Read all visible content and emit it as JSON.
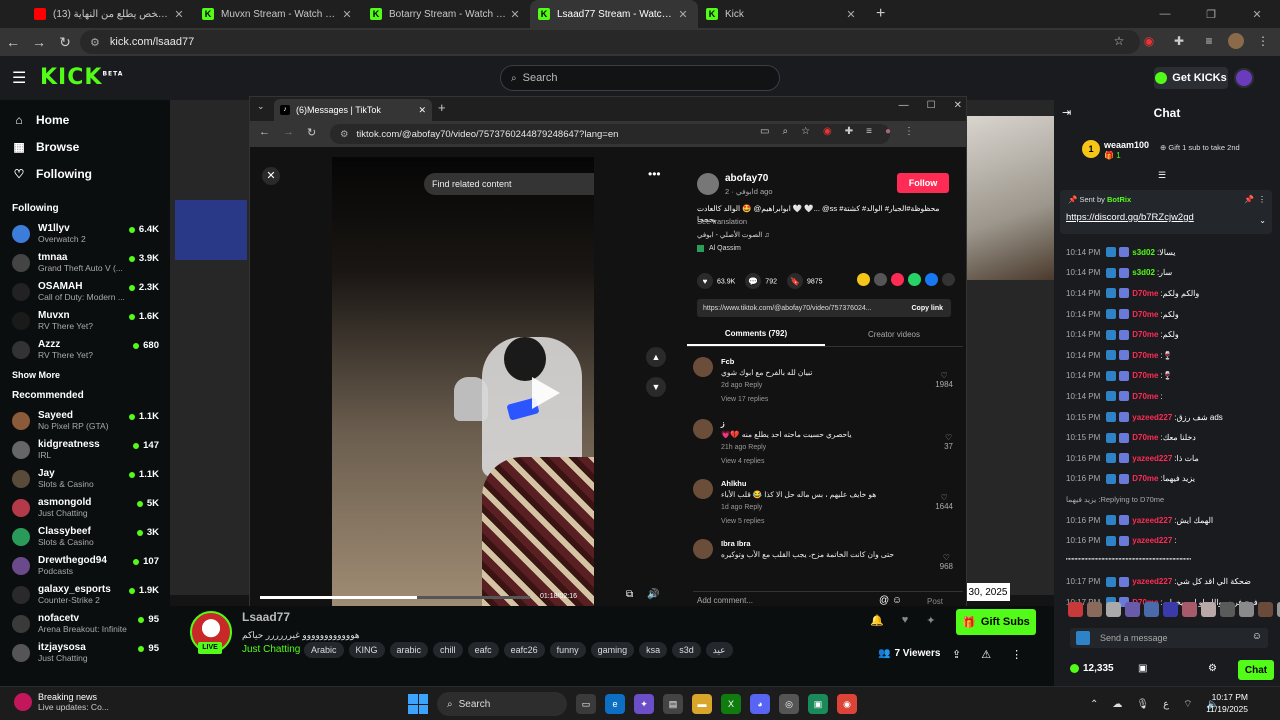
{
  "outer_browser": {
    "tabs": [
      {
        "label": "(13) اخر شخص يطلع من النهاية",
        "favicon": "youtube",
        "color": "#ff0000",
        "active": false
      },
      {
        "label": "Muvxn Stream - Watch Live on",
        "favicon": "kick",
        "color": "#53fc18",
        "active": false
      },
      {
        "label": "Botarry Stream - Watch Live on",
        "favicon": "kick",
        "color": "#53fc18",
        "active": false
      },
      {
        "label": "Lsaad77 Stream - Watch Live o",
        "favicon": "kick",
        "color": "#53fc18",
        "active": true
      },
      {
        "label": "Kick",
        "favicon": "kick",
        "color": "#53fc18",
        "active": false
      }
    ],
    "url": "kick.com/lsaad77"
  },
  "kick_header": {
    "logo": "KICK",
    "logo_badge": "BETA",
    "search_placeholder": "Search",
    "get_kicks": "Get KICKs"
  },
  "sidebar": {
    "nav": [
      {
        "label": "Home",
        "icon": "home-icon"
      },
      {
        "label": "Browse",
        "icon": "browse-icon"
      },
      {
        "label": "Following",
        "icon": "heart-icon"
      }
    ],
    "following_title": "Following",
    "following": [
      {
        "name": "W1llyv",
        "game": "Overwatch 2",
        "viewers": "6.4K",
        "color": "#3b7dd8"
      },
      {
        "name": "tmnaa",
        "game": "Grand Theft Auto V (...",
        "viewers": "3.9K",
        "color": "#444"
      },
      {
        "name": "OSAMAH",
        "game": "Call of Duty: Modern ...",
        "viewers": "2.3K",
        "color": "#222"
      },
      {
        "name": "Muvxn",
        "game": "RV There Yet?",
        "viewers": "1.6K",
        "color": "#1a1a1a"
      },
      {
        "name": "Azzz",
        "game": "RV There Yet?",
        "viewers": "680",
        "color": "#333"
      }
    ],
    "show_more": "Show More",
    "recommended_title": "Recommended",
    "recommended": [
      {
        "name": "Sayeed",
        "game": "No Pixel RP (GTA)",
        "viewers": "1.1K",
        "color": "#8a5a3a"
      },
      {
        "name": "kidgreatness",
        "game": "IRL",
        "viewers": "147",
        "color": "#666"
      },
      {
        "name": "Jay",
        "game": "Slots & Casino",
        "viewers": "1.1K",
        "color": "#5a4a3a"
      },
      {
        "name": "asmongold",
        "game": "Just Chatting",
        "viewers": "5K",
        "color": "#b43a4a"
      },
      {
        "name": "Classybeef",
        "game": "Slots & Casino",
        "viewers": "3K",
        "color": "#2a9a5a"
      },
      {
        "name": "Drewthegod94",
        "game": "Podcasts",
        "viewers": "107",
        "color": "#6a4a8a"
      },
      {
        "name": "galaxy_esports",
        "game": "Counter-Strike 2",
        "viewers": "1.9K",
        "color": "#2a2a2a"
      },
      {
        "name": "nofacetv",
        "game": "Arena Breakout: Infinite",
        "viewers": "95",
        "color": "#3a3a3a"
      },
      {
        "name": "itzjaysosa",
        "game": "Just Chatting",
        "viewers": "95",
        "color": "#555"
      }
    ]
  },
  "tiktok_window": {
    "tab_label": "(6)Messages | TikTok",
    "url": "tiktok.com/@abofay70/video/7573760244879248647?lang=en",
    "find_related": "Find related content",
    "time": "01:18/02:16",
    "progress_fraction": 0.58,
    "author": "abofay70",
    "author_sub": "ابوفي · 2d ago",
    "follow": "Follow",
    "caption": "محظوظة#الجبار# الوالد# كشتة# ss@ ...🤍 🤍 ابوابراهيم@ 🤩 الوالد كالعادت يجحجا",
    "see_translation": "See translation",
    "sound": "الصوت الأصلي - ابوفي ♫",
    "location": "Al Qassim",
    "stats": {
      "likes": "63.9K",
      "comments": "792",
      "saves": "9875"
    },
    "share_colors": [
      "#f5c518",
      "#555",
      "#fe2c55",
      "#25d366",
      "#1877f2",
      "#333"
    ],
    "link": "https://www.tiktok.com/@abofay70/video/757376024...",
    "copy_link": "Copy link",
    "tabs": [
      "Comments (792)",
      "Creator videos"
    ],
    "comments": [
      {
        "user": "Fcb",
        "text": "تبيان لله بالفرح مع ابوك شوي",
        "time": "2d ago",
        "reply": "Reply",
        "replies": "View 17 replies",
        "likes": "1984"
      },
      {
        "user": "ز",
        "text": "ياحصري حسيت ماحته احد يطلع منه 💔💗",
        "time": "21h ago",
        "reply": "Reply",
        "replies": "View 4 replies",
        "likes": "37"
      },
      {
        "user": "Ahlkhu",
        "text": "هو خايف عليهم ، بس ماله حل الا كذا 😂 قلب الأباء",
        "time": "1d ago",
        "reply": "Reply",
        "replies": "View 5 replies",
        "likes": "1644"
      },
      {
        "user": "Ibra Ibra",
        "text": "حتى وان كانت الخاتمة مزح، يجب القلب مع الأب وتوكيره",
        "time": "",
        "reply": "",
        "replies": "",
        "likes": "968"
      }
    ],
    "add_comment": "Add comment...",
    "post": "Post"
  },
  "background_date": "30, 2025",
  "channel": {
    "name": "Lsaad77",
    "title": "هوووووووووووو غيرررررر حياكم",
    "category": "Just Chatting",
    "live": "LIVE",
    "tags": [
      "Arabic",
      "KING",
      "arabic",
      "chill",
      "eafc",
      "eafc26",
      "funny",
      "gaming",
      "ksa",
      "s3d",
      "عيد"
    ],
    "gift_subs": "Gift Subs",
    "viewers": "7 Viewers"
  },
  "chat": {
    "title": "Chat",
    "gift_user": "weaam100",
    "gift_count": "1",
    "gift_text": "Gift 1 sub to take 2nd",
    "pinned_sent_by": "Sent by",
    "pinned_bot": "BotRix",
    "pinned_link": "https://discord.gg/b7RZcjw2gd",
    "messages": [
      {
        "time": "10:14 PM",
        "user": "s3d02",
        "color": "#53fc18",
        "text": "يسالا"
      },
      {
        "time": "10:14 PM",
        "user": "s3d02",
        "color": "#53fc18",
        "text": "سار"
      },
      {
        "time": "10:14 PM",
        "user": "D70me",
        "color": "#fe2c55",
        "text": "والكم ولكم"
      },
      {
        "time": "10:14 PM",
        "user": "D70me",
        "color": "#fe2c55",
        "text": "ولكم"
      },
      {
        "time": "10:14 PM",
        "user": "D70me",
        "color": "#fe2c55",
        "text": "ولكم"
      },
      {
        "time": "10:14 PM",
        "user": "D70me",
        "color": "#fe2c55",
        "text": "🍷"
      },
      {
        "time": "10:14 PM",
        "user": "D70me",
        "color": "#fe2c55",
        "text": "🍷"
      },
      {
        "time": "10:14 PM",
        "user": "D70me",
        "color": "#fe2c55",
        "text": ""
      },
      {
        "time": "10:15 PM",
        "user": "yazeed227",
        "color": "#fe2c55",
        "text": "ads شف رزق"
      },
      {
        "time": "10:15 PM",
        "user": "D70me",
        "color": "#fe2c55",
        "text": "دخلنا معك"
      },
      {
        "time": "10:16 PM",
        "user": "yazeed227",
        "color": "#fe2c55",
        "text": "مات ذا"
      },
      {
        "time": "10:16 PM",
        "user": "D70me",
        "color": "#fe2c55",
        "text": "يزيد فيهما"
      },
      {
        "time": "",
        "user": "",
        "color": "#aaa",
        "text": "Replying to D70me: يزيد فيهما"
      },
      {
        "time": "10:16 PM",
        "user": "yazeed227",
        "color": "#fe2c55",
        "text": "الهمك ايش"
      },
      {
        "time": "10:16 PM",
        "user": "yazeed227",
        "color": "#fe2c55",
        "text": ""
      },
      {
        "time": "",
        "user": "",
        "color": "#fff",
        "text": "\"\"\"\"\"\"\"\"\"\"\"\"\"\"\"\"\"\"\"\"\"\"\"\"\"\"\"\"\"\"\"\"\"\"\"\"\"\"\"\"\"\"\"\""
      },
      {
        "time": "10:17 PM",
        "user": "yazeed227",
        "color": "#fe2c55",
        "text": "ضحكة الي اقد كل شي"
      },
      {
        "time": "10:17 PM",
        "user": "D70me",
        "color": "#fe2c55",
        "text": "فرح فرحه والله او امه يخطبه"
      }
    ],
    "input_placeholder": "Send a message",
    "kicks": "12,335",
    "send": "Chat"
  },
  "taskbar": {
    "news_title": "Breaking news",
    "news_sub": "Live updates: Co...",
    "search": "Search",
    "time": "10:17 PM",
    "date": "11/19/2025"
  }
}
